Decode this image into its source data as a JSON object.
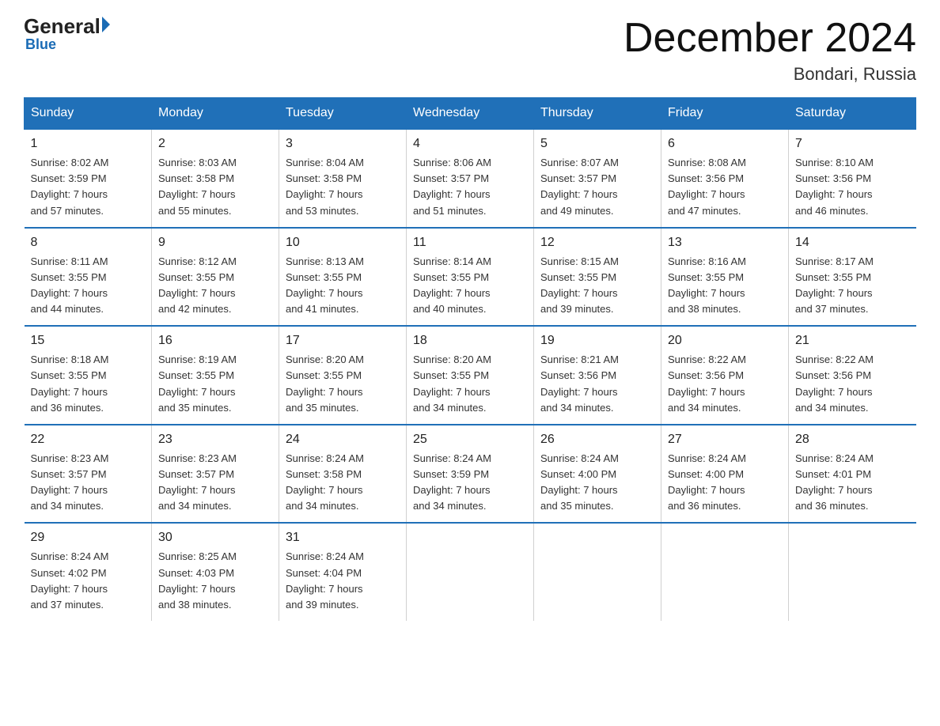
{
  "header": {
    "logo_general": "General",
    "logo_blue": "Blue",
    "month_title": "December 2024",
    "location": "Bondari, Russia"
  },
  "days_of_week": [
    "Sunday",
    "Monday",
    "Tuesday",
    "Wednesday",
    "Thursday",
    "Friday",
    "Saturday"
  ],
  "weeks": [
    [
      {
        "day": "1",
        "sunrise": "8:02 AM",
        "sunset": "3:59 PM",
        "daylight": "7 hours and 57 minutes."
      },
      {
        "day": "2",
        "sunrise": "8:03 AM",
        "sunset": "3:58 PM",
        "daylight": "7 hours and 55 minutes."
      },
      {
        "day": "3",
        "sunrise": "8:04 AM",
        "sunset": "3:58 PM",
        "daylight": "7 hours and 53 minutes."
      },
      {
        "day": "4",
        "sunrise": "8:06 AM",
        "sunset": "3:57 PM",
        "daylight": "7 hours and 51 minutes."
      },
      {
        "day": "5",
        "sunrise": "8:07 AM",
        "sunset": "3:57 PM",
        "daylight": "7 hours and 49 minutes."
      },
      {
        "day": "6",
        "sunrise": "8:08 AM",
        "sunset": "3:56 PM",
        "daylight": "7 hours and 47 minutes."
      },
      {
        "day": "7",
        "sunrise": "8:10 AM",
        "sunset": "3:56 PM",
        "daylight": "7 hours and 46 minutes."
      }
    ],
    [
      {
        "day": "8",
        "sunrise": "8:11 AM",
        "sunset": "3:55 PM",
        "daylight": "7 hours and 44 minutes."
      },
      {
        "day": "9",
        "sunrise": "8:12 AM",
        "sunset": "3:55 PM",
        "daylight": "7 hours and 42 minutes."
      },
      {
        "day": "10",
        "sunrise": "8:13 AM",
        "sunset": "3:55 PM",
        "daylight": "7 hours and 41 minutes."
      },
      {
        "day": "11",
        "sunrise": "8:14 AM",
        "sunset": "3:55 PM",
        "daylight": "7 hours and 40 minutes."
      },
      {
        "day": "12",
        "sunrise": "8:15 AM",
        "sunset": "3:55 PM",
        "daylight": "7 hours and 39 minutes."
      },
      {
        "day": "13",
        "sunrise": "8:16 AM",
        "sunset": "3:55 PM",
        "daylight": "7 hours and 38 minutes."
      },
      {
        "day": "14",
        "sunrise": "8:17 AM",
        "sunset": "3:55 PM",
        "daylight": "7 hours and 37 minutes."
      }
    ],
    [
      {
        "day": "15",
        "sunrise": "8:18 AM",
        "sunset": "3:55 PM",
        "daylight": "7 hours and 36 minutes."
      },
      {
        "day": "16",
        "sunrise": "8:19 AM",
        "sunset": "3:55 PM",
        "daylight": "7 hours and 35 minutes."
      },
      {
        "day": "17",
        "sunrise": "8:20 AM",
        "sunset": "3:55 PM",
        "daylight": "7 hours and 35 minutes."
      },
      {
        "day": "18",
        "sunrise": "8:20 AM",
        "sunset": "3:55 PM",
        "daylight": "7 hours and 34 minutes."
      },
      {
        "day": "19",
        "sunrise": "8:21 AM",
        "sunset": "3:56 PM",
        "daylight": "7 hours and 34 minutes."
      },
      {
        "day": "20",
        "sunrise": "8:22 AM",
        "sunset": "3:56 PM",
        "daylight": "7 hours and 34 minutes."
      },
      {
        "day": "21",
        "sunrise": "8:22 AM",
        "sunset": "3:56 PM",
        "daylight": "7 hours and 34 minutes."
      }
    ],
    [
      {
        "day": "22",
        "sunrise": "8:23 AM",
        "sunset": "3:57 PM",
        "daylight": "7 hours and 34 minutes."
      },
      {
        "day": "23",
        "sunrise": "8:23 AM",
        "sunset": "3:57 PM",
        "daylight": "7 hours and 34 minutes."
      },
      {
        "day": "24",
        "sunrise": "8:24 AM",
        "sunset": "3:58 PM",
        "daylight": "7 hours and 34 minutes."
      },
      {
        "day": "25",
        "sunrise": "8:24 AM",
        "sunset": "3:59 PM",
        "daylight": "7 hours and 34 minutes."
      },
      {
        "day": "26",
        "sunrise": "8:24 AM",
        "sunset": "4:00 PM",
        "daylight": "7 hours and 35 minutes."
      },
      {
        "day": "27",
        "sunrise": "8:24 AM",
        "sunset": "4:00 PM",
        "daylight": "7 hours and 36 minutes."
      },
      {
        "day": "28",
        "sunrise": "8:24 AM",
        "sunset": "4:01 PM",
        "daylight": "7 hours and 36 minutes."
      }
    ],
    [
      {
        "day": "29",
        "sunrise": "8:24 AM",
        "sunset": "4:02 PM",
        "daylight": "7 hours and 37 minutes."
      },
      {
        "day": "30",
        "sunrise": "8:25 AM",
        "sunset": "4:03 PM",
        "daylight": "7 hours and 38 minutes."
      },
      {
        "day": "31",
        "sunrise": "8:24 AM",
        "sunset": "4:04 PM",
        "daylight": "7 hours and 39 minutes."
      },
      null,
      null,
      null,
      null
    ]
  ],
  "labels": {
    "sunrise": "Sunrise:",
    "sunset": "Sunset:",
    "daylight": "Daylight:"
  }
}
